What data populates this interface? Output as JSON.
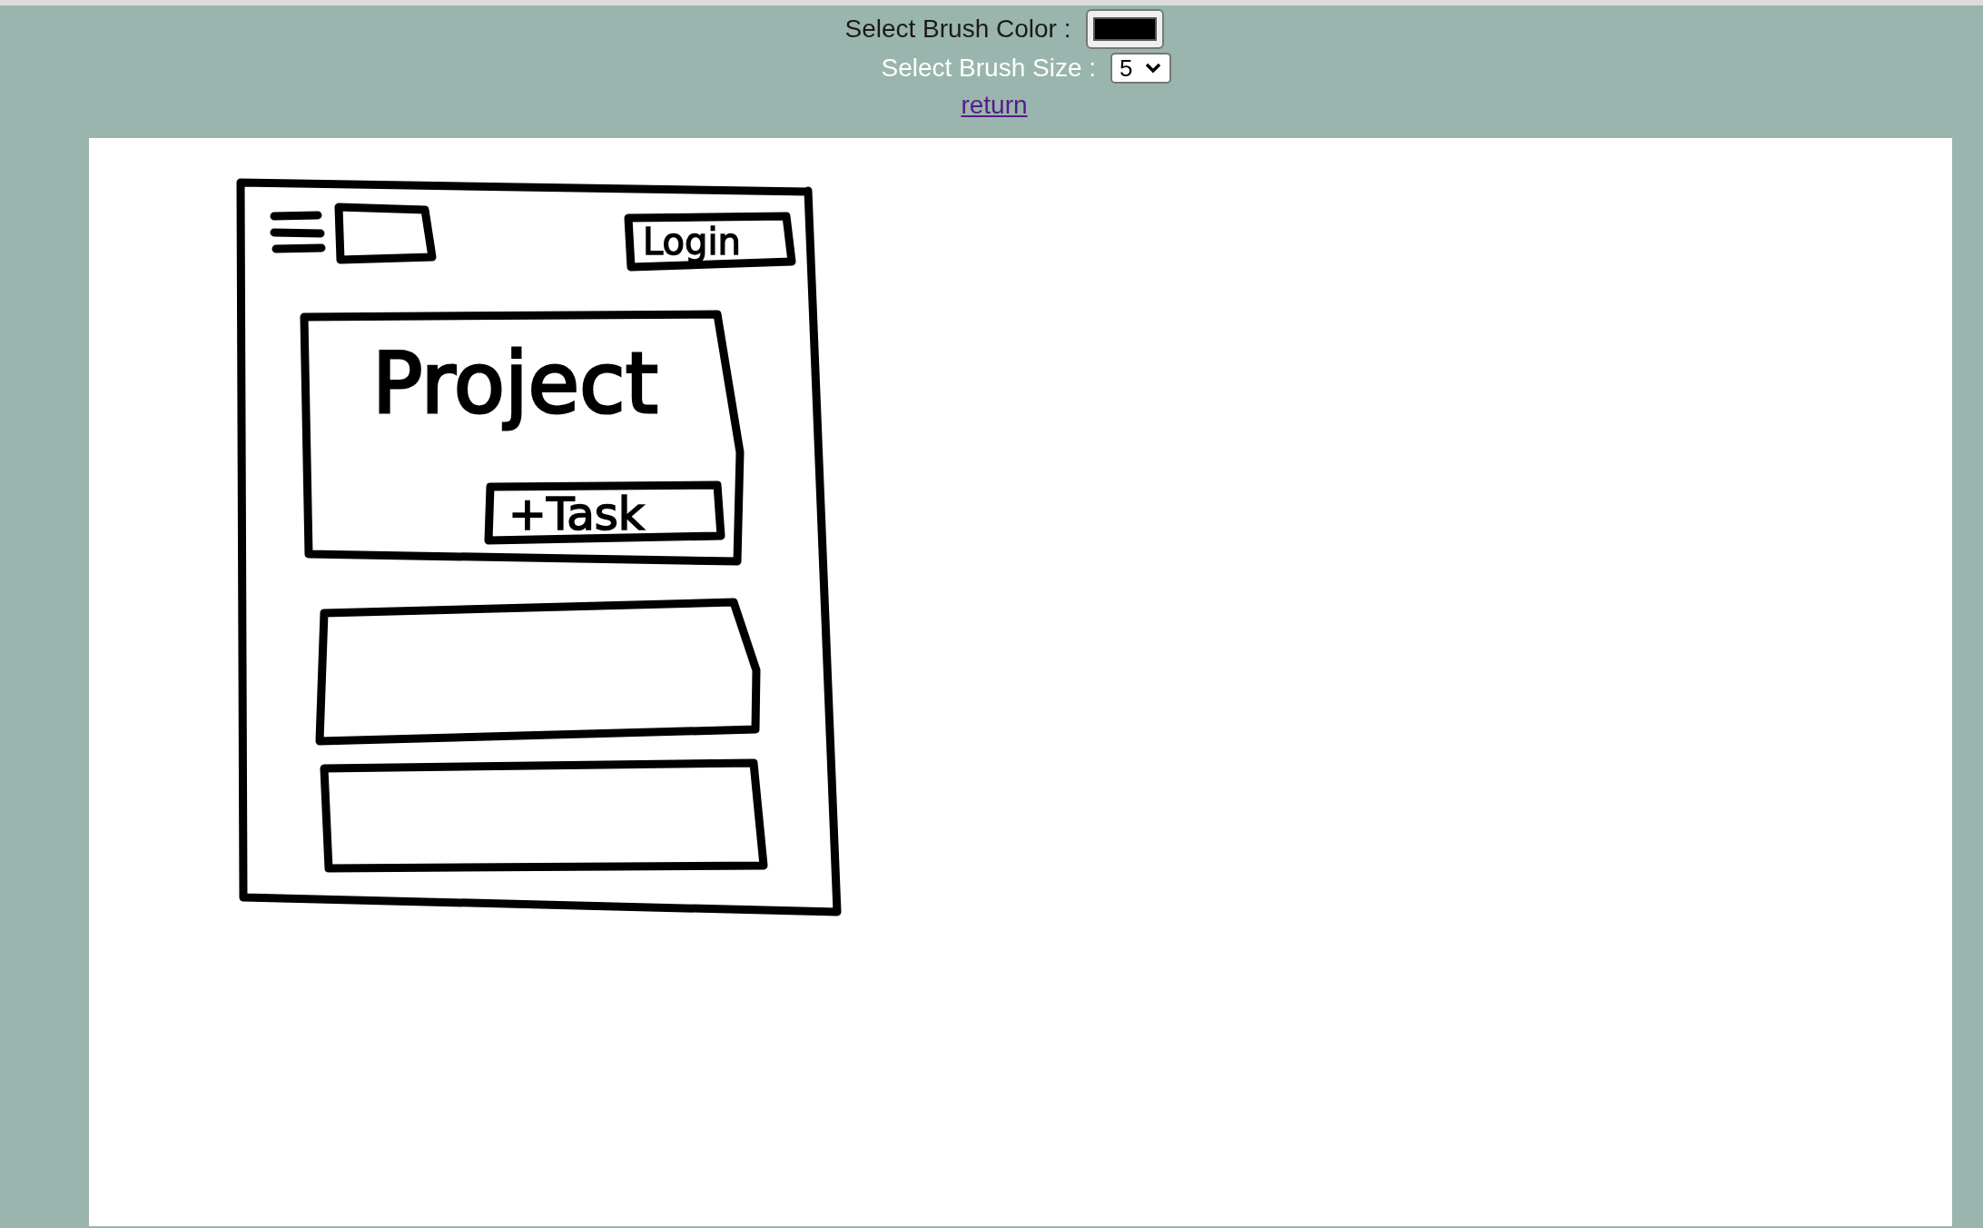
{
  "toolbar": {
    "brush_color": {
      "label": "Select Brush Color :",
      "color": "#000000"
    },
    "brush_size": {
      "label": "Select Brush Size :",
      "value": "5"
    },
    "link": "return"
  },
  "sketch": {
    "words": [
      {
        "kind": "login",
        "text": "Login"
      },
      {
        "kind": "title",
        "text": "Project"
      },
      {
        "kind": "task",
        "text": "+Task"
      }
    ]
  }
}
